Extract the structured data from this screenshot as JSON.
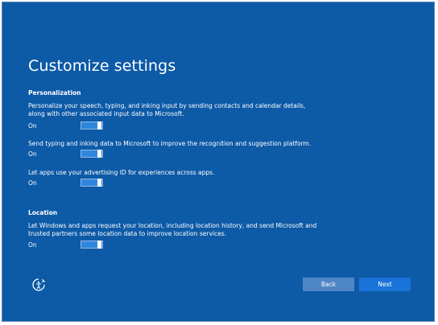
{
  "page": {
    "title": "Customize settings"
  },
  "personalization": {
    "heading": "Personalization",
    "items": [
      {
        "description": "Personalize your speech, typing, and inking input by sending contacts and calendar details, along with other associated input data to Microsoft.",
        "state_label": "On",
        "enabled": true
      },
      {
        "description": "Send typing and inking data to Microsoft to improve the recognition and suggestion platform.",
        "state_label": "On",
        "enabled": true
      },
      {
        "description": "Let apps use your advertising ID for experiences across apps.",
        "state_label": "On",
        "enabled": true
      }
    ]
  },
  "location": {
    "heading": "Location",
    "items": [
      {
        "description": "Let Windows and apps request your location, including location history, and send Microsoft and trusted partners some location data to improve location services.",
        "state_label": "On",
        "enabled": true
      }
    ]
  },
  "footer": {
    "accessibility_icon": "ease-of-access-icon",
    "back_label": "Back",
    "next_label": "Next"
  },
  "colors": {
    "background": "#0d5aa7",
    "toggle_on": "#2f86dd",
    "back_button": "#4f86c6",
    "next_button": "#1a73d9"
  }
}
